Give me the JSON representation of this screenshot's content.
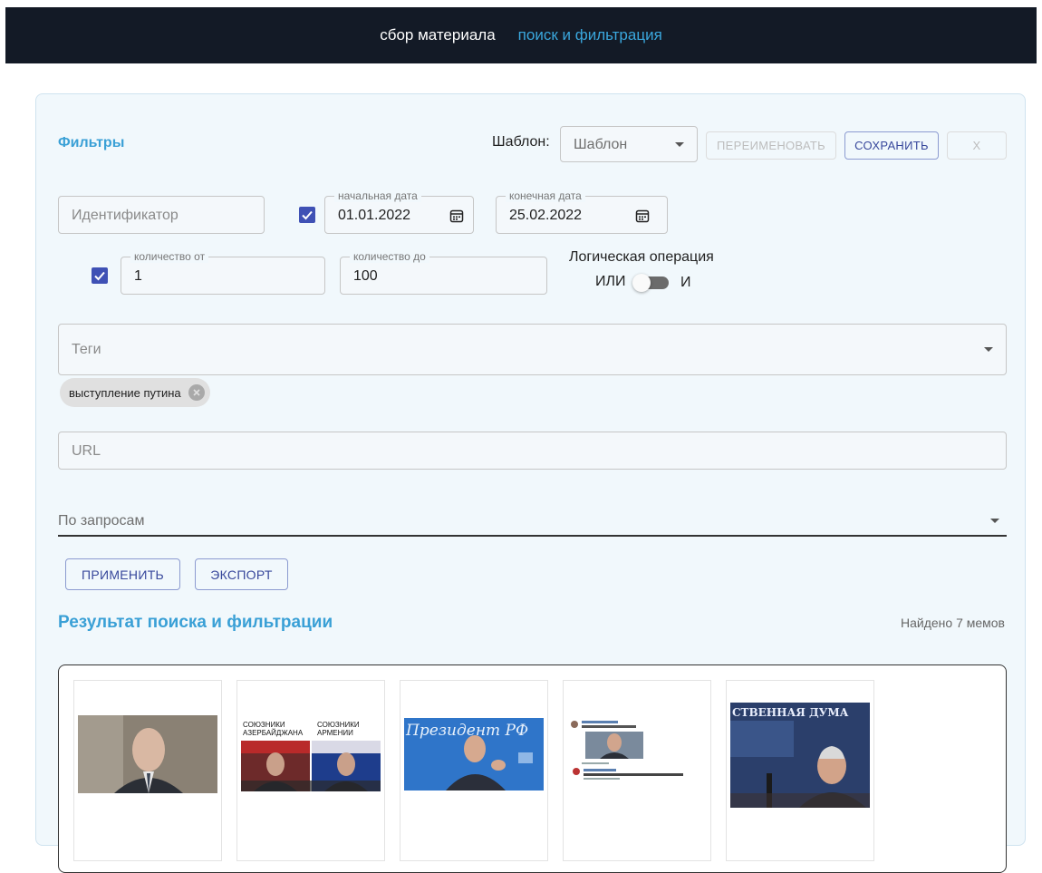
{
  "nav": {
    "items": [
      {
        "label": "сбор материала"
      },
      {
        "label": "поиск и фильтрация"
      }
    ]
  },
  "filters": {
    "title": "Фильтры",
    "template_label": "Шаблон:",
    "template_select": {
      "value": "Шаблон"
    },
    "rename_button": "ПЕРЕИМЕНОВАТЬ",
    "save_button": "СОХРАНИТЬ",
    "close_button": "X",
    "identifier": {
      "placeholder": "Идентификатор"
    },
    "date_enabled": true,
    "start_date": {
      "label": "начальная дата",
      "value": "01.01.2022"
    },
    "end_date": {
      "label": "конечная дата",
      "value": "25.02.2022"
    },
    "count_enabled": true,
    "count_from": {
      "label": "количество от",
      "value": "1"
    },
    "count_to": {
      "label": "количество до",
      "value": "100"
    },
    "logic": {
      "title": "Логическая операция",
      "left": "ИЛИ",
      "right": "И",
      "value": "ИЛИ"
    },
    "tags": {
      "placeholder": "Теги",
      "chips": [
        "выступление путина"
      ]
    },
    "url": {
      "placeholder": "URL"
    },
    "queries": {
      "placeholder": "По запросам"
    },
    "apply_button": "ПРИМЕНИТЬ",
    "export_button": "ЭКСПОРТ"
  },
  "results": {
    "title": "Результат поиска и фильтрации",
    "count": "Найдено 7 мемов",
    "cards": [
      {
        "caption": ""
      },
      {
        "caption_left": "СОЮЗНИКИ АЗЕРБАЙДЖАНА",
        "caption_right": "СОЮЗНИКИ АРМЕНИИ"
      },
      {
        "caption": "Президент РФ"
      },
      {
        "caption": ""
      },
      {
        "caption": "СТВЕННАЯ ДУМА"
      }
    ]
  },
  "colors": {
    "navbar": "#131a26",
    "accent": "#3aa0d6",
    "primary": "#3f51b5",
    "panel_bg": "#f1f8fc"
  }
}
